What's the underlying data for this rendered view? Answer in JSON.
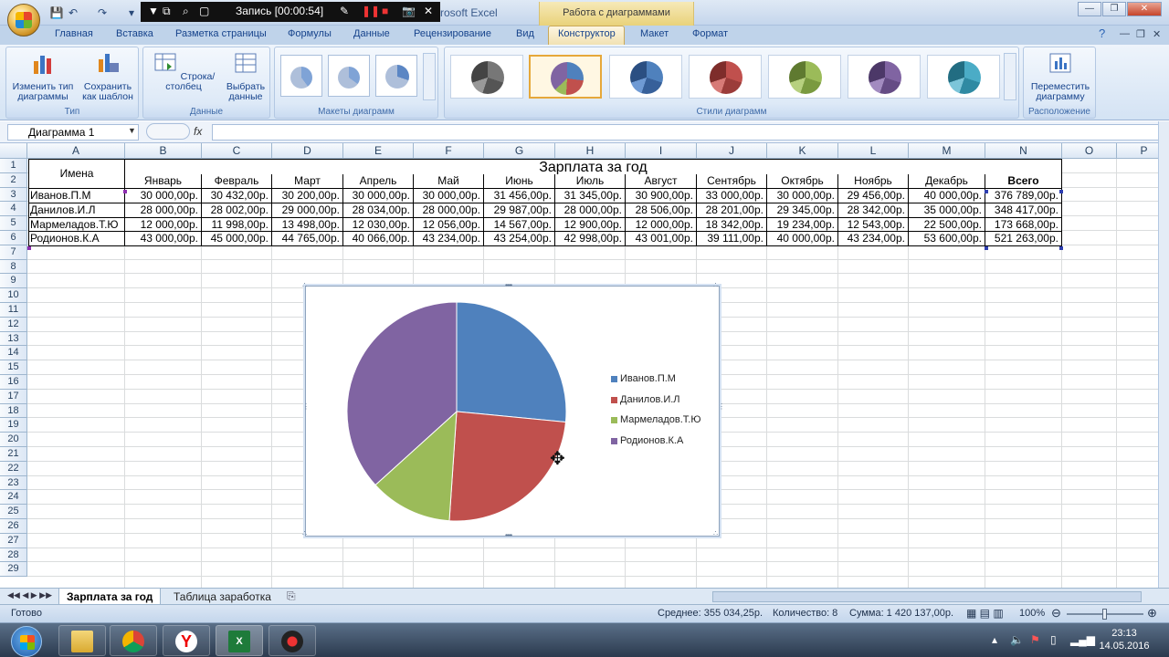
{
  "window": {
    "app_title": "rosoft Excel",
    "context_title": "Работа с диаграммами",
    "min_label": "—",
    "max_label": "❐",
    "close_label": "✕"
  },
  "recorder": {
    "label": "Запись [00:00:54]"
  },
  "tabs": [
    "Главная",
    "Вставка",
    "Разметка страницы",
    "Формулы",
    "Данные",
    "Рецензирование",
    "Вид",
    "Конструктор",
    "Макет",
    "Формат"
  ],
  "ribbon": {
    "groups": {
      "type": {
        "label": "Тип",
        "change_type": "Изменить тип диаграммы",
        "save_template": "Сохранить как шаблон"
      },
      "data": {
        "label": "Данные",
        "switch_row_col": "Строка/столбец",
        "select_data": "Выбрать данные"
      },
      "layouts": {
        "label": "Макеты диаграмм"
      },
      "styles": {
        "label": "Стили диаграмм"
      },
      "location": {
        "label": "Расположение",
        "move_chart": "Переместить диаграмму"
      }
    }
  },
  "formula_bar": {
    "name_box": "Диаграмма 1",
    "fx": "fx",
    "formula": ""
  },
  "columns": [
    "A",
    "B",
    "C",
    "D",
    "E",
    "F",
    "G",
    "H",
    "I",
    "J",
    "K",
    "L",
    "M",
    "N",
    "O",
    "P"
  ],
  "table": {
    "title": "Зарплата за год",
    "names_header": "Имена",
    "months": [
      "Январь",
      "Февраль",
      "Март",
      "Апрель",
      "Май",
      "Июнь",
      "Июль",
      "Август",
      "Сентябрь",
      "Октябрь",
      "Ноябрь",
      "Декабрь"
    ],
    "total_header": "Всего",
    "rows": [
      {
        "name": "Иванов.П.М",
        "values": [
          "30 000,00р.",
          "30 432,00р.",
          "30 200,00р.",
          "30 000,00р.",
          "30 000,00р.",
          "31 456,00р.",
          "31 345,00р.",
          "30 900,00р.",
          "33 000,00р.",
          "30 000,00р.",
          "29 456,00р.",
          "40 000,00р."
        ],
        "total": "376 789,00р."
      },
      {
        "name": "Данилов.И.Л",
        "values": [
          "28 000,00р.",
          "28 002,00р.",
          "29 000,00р.",
          "28 034,00р.",
          "28 000,00р.",
          "29 987,00р.",
          "28 000,00р.",
          "28 506,00р.",
          "28 201,00р.",
          "29 345,00р.",
          "28 342,00р.",
          "35 000,00р."
        ],
        "total": "348 417,00р."
      },
      {
        "name": "Мармеладов.Т.Ю",
        "values": [
          "12 000,00р.",
          "11 998,00р.",
          "13 498,00р.",
          "12 030,00р.",
          "12 056,00р.",
          "14 567,00р.",
          "12 900,00р.",
          "12 000,00р.",
          "18 342,00р.",
          "19 234,00р.",
          "12 543,00р.",
          "22 500,00р."
        ],
        "total": "173 668,00р."
      },
      {
        "name": "Родионов.К.А",
        "values": [
          "43 000,00р.",
          "45 000,00р.",
          "44 765,00р.",
          "40 066,00р.",
          "43 234,00р.",
          "43 254,00р.",
          "42 998,00р.",
          "43 001,00р.",
          "39 111,00р.",
          "40 000,00р.",
          "43 234,00р.",
          "53 600,00р."
        ],
        "total": "521 263,00р."
      }
    ]
  },
  "chart_data": {
    "type": "pie",
    "categories": [
      "Иванов.П.М",
      "Данилов.И.Л",
      "Мармеладов.Т.Ю",
      "Родионов.К.А"
    ],
    "values": [
      376789,
      348417,
      173668,
      521263
    ],
    "colors": [
      "#4f81bd",
      "#c0504d",
      "#9bbb59",
      "#8064a2"
    ],
    "legend_position": "right"
  },
  "sheet_tabs": [
    "Зарплата за год",
    "Таблица заработка"
  ],
  "status": {
    "ready": "Готово",
    "average": "Среднее:  355 034,25р.",
    "count": "Количество: 8",
    "sum": "Сумма:  1 420 137,00р.",
    "zoom": "100%"
  },
  "taskbar": {
    "time": "23:13",
    "date": "14.05.2016"
  }
}
